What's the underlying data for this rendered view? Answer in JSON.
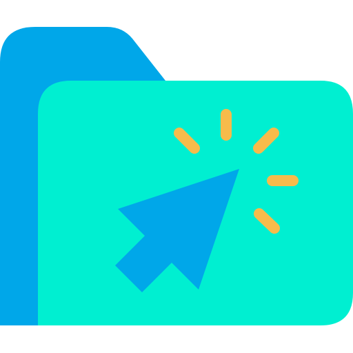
{
  "icon": {
    "name": "folder-click-icon",
    "parts": [
      "folder-back",
      "folder-front",
      "cursor-arrow",
      "click-rays"
    ]
  },
  "colors": {
    "folder_back": "#00a7e9",
    "folder_front": "#00efd1",
    "cursor": "#00a7e9",
    "rays": "#f7bb4b",
    "background": "#ffffff"
  }
}
